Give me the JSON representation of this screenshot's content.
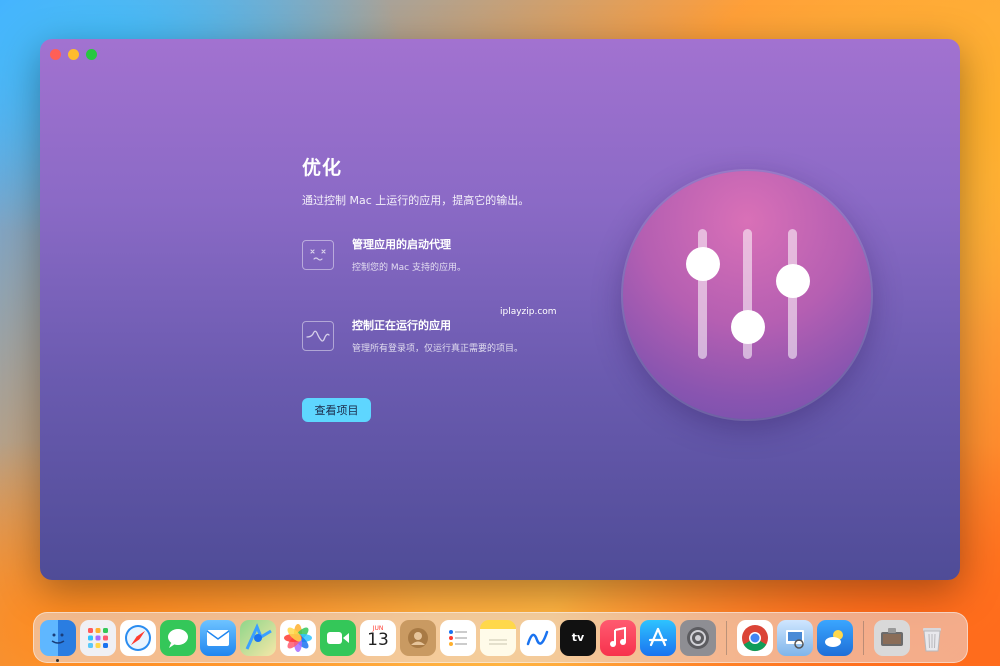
{
  "window": {
    "title": "优化",
    "subtitle": "通过控制 Mac 上运行的应用，提高它的输出。",
    "features": [
      {
        "icon": "face-x-eyes-icon",
        "title": "管理应用的启动代理",
        "desc": "控制您的 Mac 支持的应用。"
      },
      {
        "icon": "waveform-icon",
        "title": "控制正在运行的应用",
        "desc": "管理所有登录项，仅运行真正需要的项目。"
      }
    ],
    "button_label": "查看项目",
    "watermark": "iplayzip.com",
    "hero_icon": "sliders-icon"
  },
  "dock": {
    "apps": [
      {
        "name": "finder",
        "icon": "finder-icon",
        "running": true
      },
      {
        "name": "launchpad",
        "icon": "launchpad-icon"
      },
      {
        "name": "safari",
        "icon": "safari-icon"
      },
      {
        "name": "messages",
        "icon": "messages-icon"
      },
      {
        "name": "mail",
        "icon": "mail-icon"
      },
      {
        "name": "maps",
        "icon": "maps-icon"
      },
      {
        "name": "photos",
        "icon": "photos-icon"
      },
      {
        "name": "facetime",
        "icon": "facetime-icon"
      },
      {
        "name": "calendar",
        "icon": "calendar-icon",
        "month": "JUN",
        "day": "13"
      },
      {
        "name": "contacts",
        "icon": "contacts-icon"
      },
      {
        "name": "reminders",
        "icon": "reminders-icon"
      },
      {
        "name": "notes",
        "icon": "notes-icon"
      },
      {
        "name": "freeform",
        "icon": "freeform-icon"
      },
      {
        "name": "apple-tv",
        "icon": "apple-tv-icon",
        "label": "tv"
      },
      {
        "name": "music",
        "icon": "music-icon"
      },
      {
        "name": "app-store",
        "icon": "app-store-icon"
      },
      {
        "name": "system-settings",
        "icon": "settings-icon"
      },
      {
        "name": "chrome",
        "icon": "chrome-icon"
      },
      {
        "name": "preview",
        "icon": "preview-icon"
      },
      {
        "name": "weather",
        "icon": "weather-icon"
      },
      {
        "name": "screenshot",
        "icon": "screenshot-icon"
      },
      {
        "name": "trash",
        "icon": "trash-icon"
      }
    ]
  }
}
